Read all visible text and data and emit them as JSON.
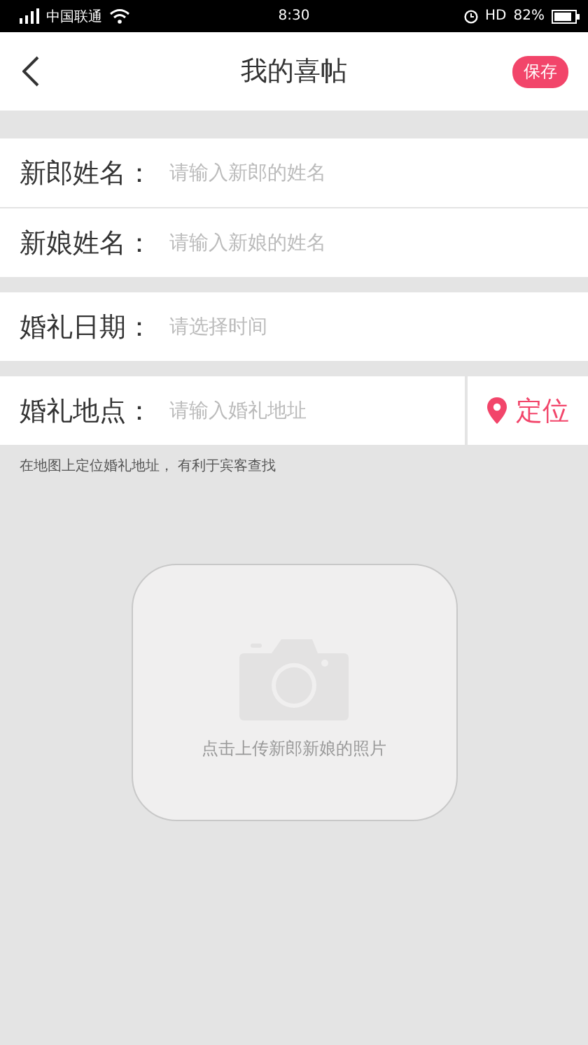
{
  "status_bar": {
    "carrier": "中国联通",
    "time": "8:30",
    "network": "HD",
    "battery": "82%"
  },
  "header": {
    "title": "我的喜帖",
    "save_button": "保存"
  },
  "groups": [
    {
      "fields": [
        {
          "label": "新郎姓名：",
          "placeholder": "请输入新郎的姓名"
        },
        {
          "label": "新娘姓名：",
          "placeholder": "请输入新娘的姓名"
        }
      ]
    },
    {
      "fields": [
        {
          "label": "婚礼日期：",
          "placeholder": "请选择时间"
        }
      ]
    },
    {
      "fields": [
        {
          "label": "婚礼地点：",
          "placeholder": "请输入婚礼地址",
          "action": "定位"
        }
      ]
    }
  ],
  "hint": "在地图上定位婚礼地址， 有利于宾客查找",
  "upload": {
    "label": "点击上传新郎新娘的照片"
  }
}
